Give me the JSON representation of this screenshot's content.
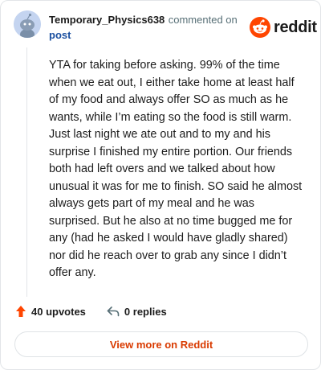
{
  "comment": {
    "author": "Temporary_Physics638",
    "action": "commented on",
    "target": "post",
    "body": "YTA for taking before asking. 99% of the time when we eat out, I either take home at least half of my food and always offer SO as much as he wants, while I’m eating so the food is still warm. Just last night we ate out and to my and his surprise I finished my entire portion. Our friends both had left overs and we talked about how unusual it was for me to finish. SO said he almost always gets part of my meal and he was surprised. But he also at no time bugged me for any (had he asked I would have gladly shared) nor did he reach over to grab any since I didn’t offer any.",
    "upvotes": "40 upvotes",
    "replies": "0 replies"
  },
  "brand": {
    "name": "reddit",
    "accent": "#ff4500"
  },
  "icons": {
    "avatar": "snoo-avatar-icon",
    "logo": "reddit-logo-icon",
    "upvote": "upvote-arrow-icon",
    "reply": "reply-arrow-icon"
  },
  "cta": {
    "label": "View more on Reddit",
    "color": "#d93a00"
  }
}
